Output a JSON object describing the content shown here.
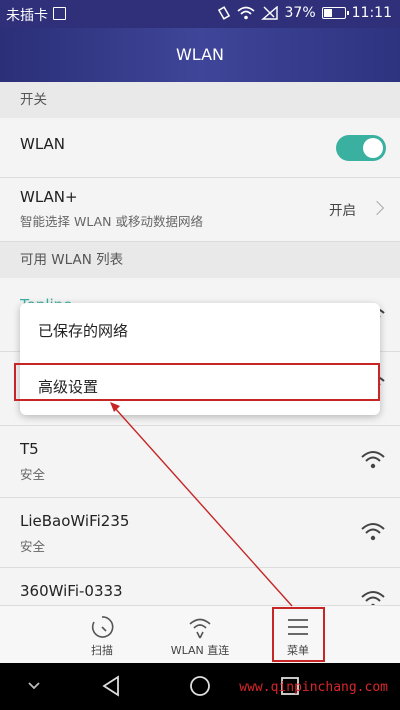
{
  "status_bar": {
    "carrier": "未插卡",
    "battery": "37%",
    "time": "11:11"
  },
  "title_bar": {
    "title": "WLAN"
  },
  "sections": {
    "switch": "开关",
    "available": "可用 WLAN 列表"
  },
  "wlan_row": {
    "label": "WLAN",
    "toggle_on": true
  },
  "wlan_plus_row": {
    "label": "WLAN+",
    "subtitle": "智能选择 WLAN 或移动数据网络",
    "value": "开启"
  },
  "networks": [
    {
      "name": "Topline",
      "status": ""
    },
    {
      "name": "T5",
      "status": "安全"
    },
    {
      "name": "LieBaoWiFi235",
      "status": "安全"
    },
    {
      "name": "360WiFi-0333",
      "status": ""
    }
  ],
  "menu": {
    "items": [
      "已保存的网络",
      "高级设置"
    ]
  },
  "bottom_tabs": [
    {
      "label": "扫描",
      "icon": "scan-icon"
    },
    {
      "label": "WLAN 直连",
      "icon": "wifi-direct-icon"
    },
    {
      "label": "菜单",
      "icon": "menu-icon"
    }
  ],
  "watermark": "www.qinpinchang.com",
  "colors": {
    "accent": "#3ab0a0",
    "title_bar": "#3a4090",
    "annotation": "#c62626"
  }
}
